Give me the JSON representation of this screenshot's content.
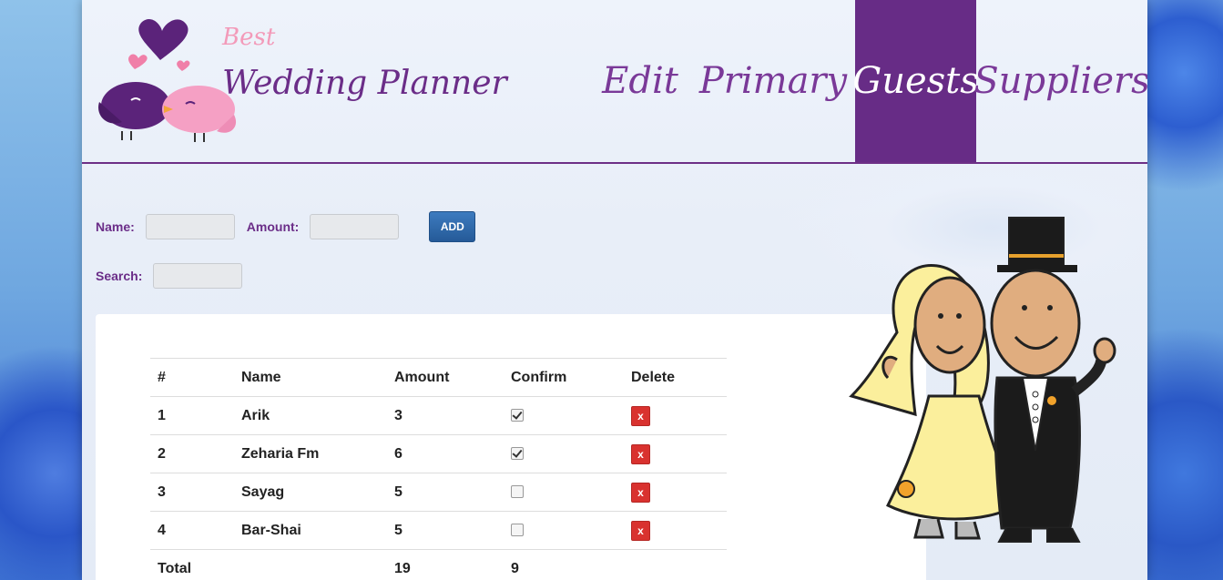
{
  "logo": {
    "best": "Best",
    "title": "Wedding Planner"
  },
  "nav": {
    "edit": "Edit",
    "primary": "Primary",
    "guests": "Guests",
    "suppliers": "Suppliers"
  },
  "form": {
    "name_label": "Name:",
    "amount_label": "Amount:",
    "add_label": "ADD",
    "search_label": "Search:"
  },
  "table": {
    "headers": [
      "#",
      "Name",
      "Amount",
      "Confirm",
      "Delete"
    ],
    "rows": [
      {
        "num": "1",
        "name": "Arik",
        "amount": "3",
        "confirmed": true
      },
      {
        "num": "2",
        "name": "Zeharia Fm",
        "amount": "6",
        "confirmed": true
      },
      {
        "num": "3",
        "name": "Sayag",
        "amount": "5",
        "confirmed": false
      },
      {
        "num": "4",
        "name": "Bar-Shai",
        "amount": "5",
        "confirmed": false
      }
    ],
    "delete_label": "x",
    "total": {
      "label": "Total",
      "amount": "19",
      "confirm": "9"
    }
  },
  "colors": {
    "accent": "#672c86",
    "nav_text": "#7a3998",
    "delete": "#d9322f",
    "add_button": "#2d67a8"
  },
  "icons": [
    "lovebirds-heart-icon",
    "checkbox-icon",
    "close-icon",
    "bride-groom-illustration"
  ]
}
